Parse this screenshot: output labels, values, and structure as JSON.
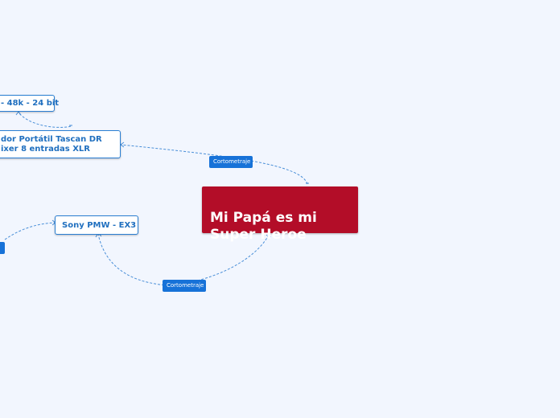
{
  "mindmap": {
    "root": {
      "label": "Mi Papá es mi\nSuper Heroe",
      "color": "#b30d28"
    },
    "nodes": {
      "sample_rate": {
        "label": "- 48k - 24 bit"
      },
      "recorder_line1": {
        "label": "dor Portátil Tascan DR"
      },
      "recorder_line2": {
        "label": "ixer 8 entradas XLR"
      },
      "camera": {
        "label": "Sony PMW - EX3"
      }
    },
    "connection_labels": {
      "upper": "Cortometraje",
      "lower": "Cortometraje"
    },
    "colors": {
      "background": "#f2f6fe",
      "node_border": "#2a7fd3",
      "node_text": "#1f6fbf",
      "connector": "#4a8fd8",
      "pill": "#1772d8"
    }
  }
}
